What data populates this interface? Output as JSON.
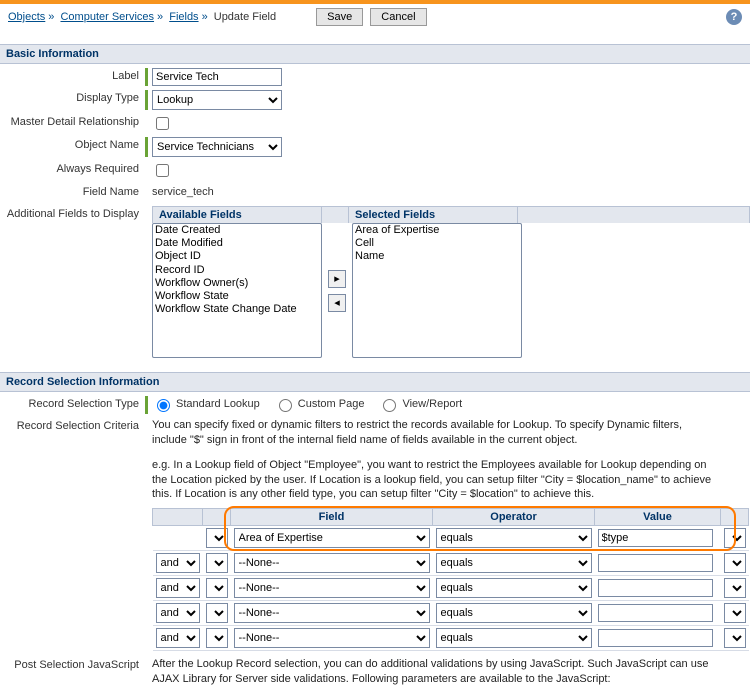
{
  "breadcrumb": {
    "items": [
      "Objects",
      "Computer Services",
      "Fields"
    ],
    "current": "Update Field"
  },
  "header": {
    "save": "Save",
    "cancel": "Cancel"
  },
  "sections": {
    "basic": "Basic Information",
    "record_sel": "Record Selection Information"
  },
  "basic": {
    "labels": {
      "label": "Label",
      "display_type": "Display Type",
      "master_detail": "Master Detail Relationship",
      "object_name": "Object Name",
      "always_required": "Always Required",
      "field_name": "Field Name",
      "additional": "Additional Fields to Display"
    },
    "values": {
      "label": "Service Tech",
      "display_type": "Lookup",
      "object_name": "Service Technicians",
      "field_name": "service_tech"
    },
    "picker": {
      "available_header": "Available Fields",
      "selected_header": "Selected Fields",
      "available": [
        "Date Created",
        "Date Modified",
        "Object ID",
        "Record ID",
        "Workflow Owner(s)",
        "Workflow State",
        "Workflow State Change Date"
      ],
      "selected": [
        "Area of Expertise",
        "Cell",
        "Name"
      ]
    }
  },
  "record": {
    "labels": {
      "type": "Record Selection Type",
      "criteria": "Record Selection Criteria",
      "post_js": "Post Selection JavaScript"
    },
    "type_options": {
      "standard": "Standard Lookup",
      "custom": "Custom Page",
      "view": "View/Report"
    },
    "criteria_text1": "You can specify fixed or dynamic filters to restrict the records available for Lookup. To specify Dynamic filters, include \"$\" sign in front of the internal field name of fields available in the current object.",
    "criteria_text2": "e.g. In a Lookup field of Object \"Employee\", you want to restrict the Employees available for Lookup depending on the Location picked by the user. If Location is a lookup field, you can setup filter \"City = $location_name\" to achieve this. If Location is any other field type, you can setup filter \"City = $location\" to achieve this.",
    "post_js_text": "After the Lookup Record selection, you can do additional validations by using JavaScript. Such JavaScript can use AJAX Library for Server side validations. Following parameters are available to the JavaScript:",
    "table": {
      "headers": {
        "field": "Field",
        "operator": "Operator",
        "value": "Value"
      },
      "join": "and",
      "rows": [
        {
          "field": "Area of Expertise",
          "op": "equals",
          "val": "$type"
        },
        {
          "field": "--None--",
          "op": "equals",
          "val": ""
        },
        {
          "field": "--None--",
          "op": "equals",
          "val": ""
        },
        {
          "field": "--None--",
          "op": "equals",
          "val": ""
        },
        {
          "field": "--None--",
          "op": "equals",
          "val": ""
        }
      ]
    }
  }
}
